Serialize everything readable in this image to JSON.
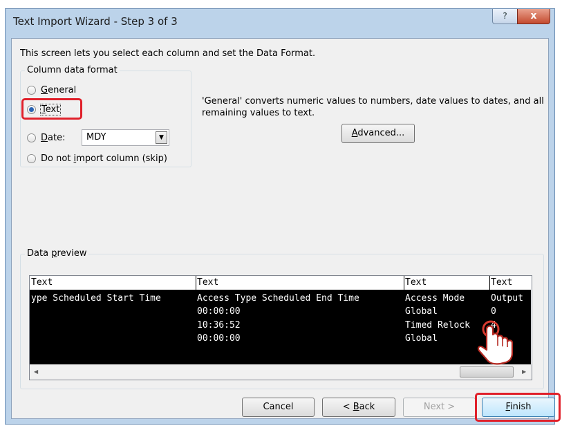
{
  "window": {
    "title": "Text Import Wizard - Step 3 of 3",
    "help_label": "?",
    "close_label": "x"
  },
  "intro": "This screen lets you select each column and set the Data Format.",
  "column_format": {
    "legend": "Column data format",
    "options": [
      {
        "label": "General",
        "checked": false
      },
      {
        "label": "Text",
        "checked": true
      },
      {
        "label": "Date:",
        "checked": false
      },
      {
        "label": "Do not import column (skip)",
        "checked": false
      }
    ],
    "date_format": "MDY"
  },
  "description": "'General' converts numeric values to numbers, date values to dates, and all remaining values to text.",
  "advanced_label": "Advanced...",
  "preview": {
    "legend": "Data preview",
    "headers": [
      "Text",
      "Text",
      "Text",
      "Text"
    ],
    "rows": [
      [
        "ype Scheduled Start Time",
        "Access Type Scheduled End Time",
        "Access Mode",
        "Output"
      ],
      [
        "",
        "00:00:00",
        "Global",
        "0"
      ],
      [
        "",
        "10:36:52",
        "Timed Relock",
        "4"
      ],
      [
        "",
        "00:00:00",
        "Global",
        "0"
      ]
    ]
  },
  "buttons": {
    "cancel": "Cancel",
    "back": "< Back",
    "next": "Next >",
    "finish": "Finish"
  },
  "colors": {
    "highlight": "#e0202a",
    "preview_selected_bg": "#000000",
    "window_frame": "#bcd3ea"
  }
}
